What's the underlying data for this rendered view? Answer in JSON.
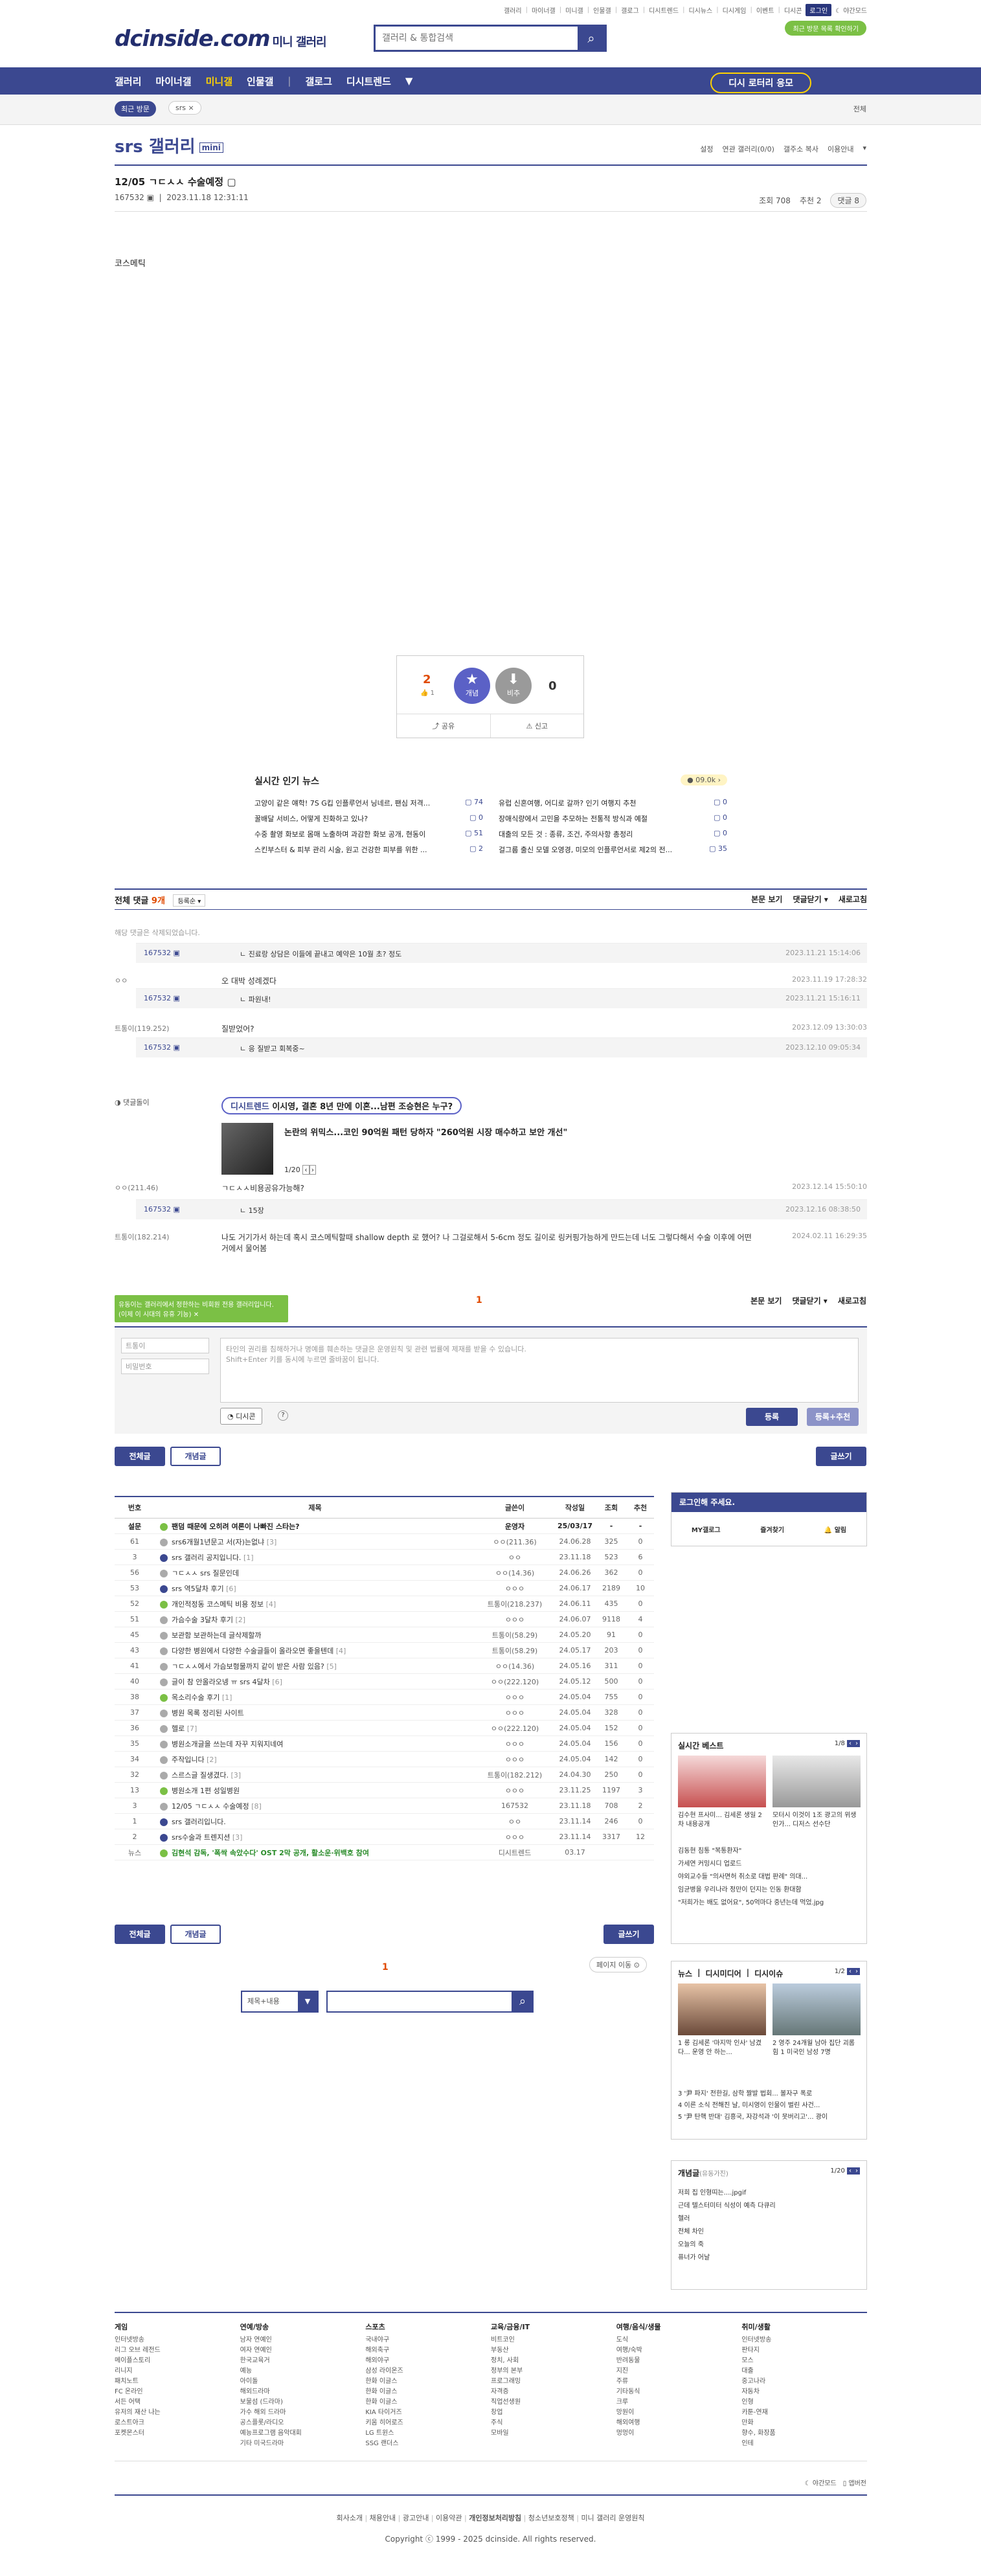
{
  "top_links": [
    "갤러리",
    "마이너갤",
    "미니갤",
    "인물갤",
    "갤로그",
    "디시트렌드",
    "디시뉴스",
    "디시게임",
    "이벤트",
    "디시콘"
  ],
  "login_label": "로그인",
  "night_label": "야간모드",
  "recent_visit_btn": "최근 방문 목록 확인하기",
  "logo": {
    "main": "dcinside.com",
    "sub": "미니 갤러리"
  },
  "search": {
    "placeholder": "갤러리 & 통합검색"
  },
  "gnb": {
    "items": [
      "갤러리",
      "마이너갤",
      "미니갤",
      "인물갤",
      "갤로그",
      "디시트렌드"
    ],
    "lottery": "디시 로터리 응모"
  },
  "gnb2": {
    "recent": "최근 방문",
    "mini": "srs",
    "all": "전체"
  },
  "gallery": {
    "title": "srs 갤러리",
    "badge": "mini",
    "menu": [
      "설정",
      "연관 갤러리(0/0)",
      "갤주소 복사",
      "이용안내"
    ]
  },
  "post": {
    "title": "12/05 ㄱㄷㅅㅅ 수술예정",
    "author": "167532",
    "date": "2023.11.18 12:31:11",
    "views": "조회 708",
    "recommend": "추천 2",
    "comments": "댓글 8",
    "body": "코스메틱"
  },
  "vote": {
    "up_count": "2",
    "fix_count": "1",
    "down_count": "0",
    "up_label": "개념",
    "down_label": "비추",
    "share": "공유",
    "report": "신고"
  },
  "news": {
    "title": "실시간 인기 뉴스",
    "points": "09.0k",
    "items": [
      {
        "t": "고양이 같은 얘학! 7S G킵 인플루언서 닝네르, 팬심 저격...",
        "c": "74"
      },
      {
        "t": "유럽 신혼여행, 어디로 갈까? 인기 여행지 추천",
        "c": "0"
      },
      {
        "t": "꿀배달 서비스, 어떻게 진화하고 있나?",
        "c": "0"
      },
      {
        "t": "장애식량에서 고민을 추모하는 전통적 방식과 예절",
        "c": "0"
      },
      {
        "t": "수중 촬영 화보로 몸매 노출하며 과감한 화보 공개, 현동이",
        "c": "51"
      },
      {
        "t": "대출의 모든 것 : 종류, 조건, 주의사항 총정리",
        "c": "0"
      },
      {
        "t": "스킨부스터 & 피부 관리 시술, 원고 건강한 피부를 위한 ...",
        "c": "2"
      },
      {
        "t": "걸그룹 출신 모델 오영경, 미모의 인플루언서로 제2의 전...",
        "c": "35"
      }
    ]
  },
  "comments": {
    "head": "전체 댓글",
    "count": "9개",
    "sort": "등록순",
    "actions": [
      "본문 보기",
      "댓글닫기",
      "새로고침"
    ],
    "deleted": "해당 댓글은 삭제되었습니다.",
    "rows": [
      {
        "type": "reply",
        "nick": "167532",
        "text": "ㄴ 진료랑 상담은 이들에 끝내고 예약은 10월 초? 정도",
        "time": "2023.11.21 15:14:06"
      },
      {
        "type": "main",
        "nick": "ㅇㅇ",
        "text": "오 대박 성례겠다",
        "time": "2023.11.19 17:28:32"
      },
      {
        "type": "reply",
        "nick": "167532",
        "text": "ㄴ 파원내!",
        "time": "2023.11.21 15:16:11"
      },
      {
        "type": "main",
        "nick": "트통이(119.252)",
        "text": "질받었어?",
        "time": "2023.12.09 13:30:03"
      },
      {
        "type": "reply",
        "nick": "167532",
        "text": "ㄴ 응 질받고 회복중~",
        "time": "2023.12.10 09:05:34"
      },
      {
        "type": "main",
        "nick": "ㅇㅇ(211.46)",
        "text": "ㄱㄷㅅㅅ비용공유가능해?",
        "time": "2023.12.14 15:50:10"
      },
      {
        "type": "reply",
        "nick": "167532",
        "text": "ㄴ 15장",
        "time": "2023.12.16 08:38:50"
      },
      {
        "type": "main",
        "nick": "트통이(182.214)",
        "text": "나도 거기가서 하는데 혹시 코스메틱할때 shallow depth 로 했어? 나 그걸로해서 5-6cm 정도 길이로 링커핑가능하게 만드는데 너도 그렇다해서 수술 이후에 어떤거에서 물어봄",
        "time": "2024.02.11 16:29:35"
      }
    ]
  },
  "ad": {
    "label": "댓글돌이",
    "brand": "디시트렌드",
    "title": "이시영, 결혼 8년 만에 이혼...남편 조승현은 누구?",
    "headline": "논란의 위믹스...코인 90억원 패턴 당하자 \"260억원 시장 매수하고 보안 개선\"",
    "pager": "1/20"
  },
  "write": {
    "tip": "유동이는 갤러리에서 정한하는 비회원 전용 갤러리입니다. (이제 이 시대의 유휴 기능)",
    "nick_ph": "트통이",
    "pw_ph": "비밀번호",
    "textarea": "타인의 권리를 침해하거나 명예를 훼손하는 댓글은 운영원칙 및 관련 법률에 제재를 받을 수 있습니다.\nShift+Enter 키를 동시에 누르면 줄바꿈이 됩니다.",
    "dccon": "디시콘",
    "submit": "등록",
    "submit_rec": "등록+추천",
    "page": "1"
  },
  "list_tabs": {
    "all": "전체글",
    "concept": "개념글",
    "write": "글쓰기"
  },
  "board": {
    "headers": [
      "번호",
      "제목",
      "글쓴이",
      "작성일",
      "조회",
      "추천"
    ],
    "rows": [
      {
        "n": "설문",
        "t": "팬덤 때문에 오히려 여론이 나빠진 스타는?",
        "w": "운영자",
        "d": "25/03/17",
        "v": "-",
        "r": "-",
        "notice": true,
        "ic": "#7bc045"
      },
      {
        "n": "61",
        "t": "srs6개월1년문고 서(자)는없냐",
        "cc": "[3]",
        "w": "ㅇㅇ(211.36)",
        "d": "24.06.28",
        "v": "325",
        "r": "0",
        "ic": "#aaa"
      },
      {
        "n": "3",
        "t": "srs 갤러리 공지입니다.",
        "cc": "[1]",
        "w": "ㅇㅇ",
        "d": "23.11.18",
        "v": "523",
        "r": "6",
        "ic": "#3b4890"
      },
      {
        "n": "56",
        "t": "ㄱㄷㅅㅅ srs 질문인데",
        "w": "ㅇㅇ(14.36)",
        "d": "24.06.26",
        "v": "362",
        "r": "0",
        "ic": "#aaa"
      },
      {
        "n": "53",
        "t": "srs 역5달차 후기",
        "cc": "[6]",
        "w": "ㅇㅇㅇ",
        "d": "24.06.17",
        "v": "2189",
        "r": "10",
        "ic": "#3b4890"
      },
      {
        "n": "52",
        "t": "개인적정동 코스메틱 비용 정보",
        "cc": "[4]",
        "w": "트통이(218.237)",
        "d": "24.06.11",
        "v": "435",
        "r": "0",
        "ic": "#7bc045"
      },
      {
        "n": "51",
        "t": "가슴수술 3달차 후기",
        "cc": "[2]",
        "w": "ㅇㅇㅇ",
        "d": "24.06.07",
        "v": "9118",
        "r": "4",
        "ic": "#aaa"
      },
      {
        "n": "45",
        "t": "보관함 보관하는데 글삭제할까",
        "w": "트통이(58.29)",
        "d": "24.05.20",
        "v": "91",
        "r": "0",
        "ic": "#aaa"
      },
      {
        "n": "43",
        "t": "다양한 병원에서 다양한 수술글들이 올라오면 좋을텐데",
        "cc": "[4]",
        "w": "트통이(58.29)",
        "d": "24.05.17",
        "v": "203",
        "r": "0",
        "ic": "#aaa"
      },
      {
        "n": "41",
        "t": "ㄱㄷㅅㅅ에서 가슴보형물까지 같이 받은 사람 있음?",
        "cc": "[5]",
        "w": "ㅇㅇ(14.36)",
        "d": "24.05.16",
        "v": "311",
        "r": "0",
        "ic": "#aaa"
      },
      {
        "n": "40",
        "t": "글이 참 안올라오넹 ㅠ srs 4달차",
        "cc": "[6]",
        "w": "ㅇㅇ(222.120)",
        "d": "24.05.12",
        "v": "500",
        "r": "0",
        "ic": "#aaa"
      },
      {
        "n": "38",
        "t": "목소리수술 후기",
        "cc": "[1]",
        "w": "ㅇㅇㅇ",
        "d": "24.05.04",
        "v": "755",
        "r": "0",
        "ic": "#7bc045"
      },
      {
        "n": "37",
        "t": "병원 목록 정리된 사이트",
        "w": "ㅇㅇㅇ",
        "d": "24.05.04",
        "v": "328",
        "r": "0",
        "ic": "#aaa"
      },
      {
        "n": "36",
        "t": "헬로",
        "cc": "[7]",
        "w": "ㅇㅇ(222.120)",
        "d": "24.05.04",
        "v": "152",
        "r": "0",
        "ic": "#aaa"
      },
      {
        "n": "35",
        "t": "병원소개글을 쓰는데 자꾸 지워지네여",
        "w": "ㅇㅇㅇ",
        "d": "24.05.04",
        "v": "156",
        "r": "0",
        "ic": "#aaa"
      },
      {
        "n": "34",
        "t": "주작입니다",
        "cc": "[2]",
        "w": "ㅇㅇㅇ",
        "d": "24.05.04",
        "v": "142",
        "r": "0",
        "ic": "#aaa"
      },
      {
        "n": "32",
        "t": "스르스글 질생겼다.",
        "cc": "[3]",
        "w": "트통이(182.212)",
        "d": "24.04.30",
        "v": "250",
        "r": "0",
        "ic": "#aaa"
      },
      {
        "n": "13",
        "t": "병원소개 1편 성일병원",
        "w": "ㅇㅇㅇ",
        "d": "23.11.25",
        "v": "1197",
        "r": "3",
        "ic": "#7bc045"
      },
      {
        "n": "3",
        "t": "12/05 ㄱㄷㅅㅅ 수술예정",
        "cc": "[8]",
        "w": "167532",
        "d": "23.11.18",
        "v": "708",
        "r": "2",
        "ic": "#aaa"
      },
      {
        "n": "1",
        "t": "srs 갤러리입니다.",
        "w": "ㅇㅇ",
        "d": "23.11.14",
        "v": "246",
        "r": "0",
        "ic": "#3b4890"
      },
      {
        "n": "2",
        "t": "srs수술과 트렌지션",
        "cc": "[3]",
        "w": "ㅇㅇㅇ",
        "d": "23.11.14",
        "v": "3317",
        "r": "12",
        "ic": "#3b4890"
      },
      {
        "n": "뉴스",
        "t": "김현석 감독, '폭싹 속았수다' OST 2막 공개, 활소운·위백호 참여",
        "w": "디시트렌드",
        "d": "03.17",
        "v": "",
        "r": "",
        "ic": "#7bc045",
        "news": true
      }
    ]
  },
  "pagination": {
    "current": "1",
    "goto": "페이지 이동"
  },
  "bottom_search": {
    "type": "제목+내용"
  },
  "side": {
    "login": "로그인해 주세요.",
    "mygallog": "MY갤로그",
    "fav": "즐겨찾기",
    "alarm": "알림",
    "best_title": "실시간 베스트",
    "best_page": "1/8",
    "best_items": [
      "김수현 프사미... 김세론 생일 2차 내용공개",
      "모터시 이것이 1조 광고의 위생인가... 디저스 선수단"
    ],
    "best_list": [
      "김동현 침통 \"복통환자\"",
      "가세연 커밍시디 업로드",
      "야외교수들 \"의사면허 취소로 대법 판례\" 의대...",
      "임균병을 우리나라 정만이 던지는 인동 환대함",
      "\"저희가는 배도 없어요\", 50억마다 중년는데 먹었.jpg"
    ],
    "news_tabs": [
      "뉴스",
      "디시미디어",
      "디시이슈"
    ],
    "news_page": "1/2",
    "news_caps": [
      "1 롱 김세론 '마지막 인사' 남겼다... 운영 안 하는...",
      "2 영주 24개월 남아 집단 괴롭힘 1 미국인 남성 7명"
    ],
    "news_list": [
      "3 '尹 파지' 전한길, 삼학 짤발 법회... 볼자구 폭로",
      "4 이른 소식 전해진 날, 미시영이 인물이 벌린 사건...",
      "5 '尹 탄핵 반대' 김흥국, 자강석과 '이 못버리고'... 광이"
    ],
    "concept_title": "개념글",
    "concept_sub": "(유동가진)",
    "concept_page": "1/20",
    "concept_list": [
      "저희 집 인형띠는....jpgif",
      "근데 텔스터미터 식성이 예측 다큐리",
      "헬러",
      "전체 차인",
      "오늘의 죽",
      "퓨너가 어날"
    ]
  },
  "footer": {
    "cols": [
      {
        "h": "게임",
        "items": [
          "인터넷방송",
          "리그 오브 레전드",
          "메이플스토리",
          "리니지",
          "패치노트",
          "FC 온라인",
          "서든 어택",
          "유저의 재산 나는",
          "로스트아크",
          "포켓몬스터"
        ]
      },
      {
        "h": "연예/방송",
        "items": [
          "남자 연예인",
          "여자 연예인",
          "한국교육거",
          "예능",
          "아이돌",
          "해외드라마",
          "보물섬 (드라마)",
          "가수 해외 드라마",
          "공스플롯/라디오",
          "예능프로그램 음악대회",
          "기타 미국드라마"
        ]
      },
      {
        "h": "스포츠",
        "items": [
          "국내야구",
          "해외축구",
          "해외야구",
          "삼성 라이온즈",
          "한화 이글스",
          "한화 이글스",
          "한화 이글스",
          "KIA 타이거즈",
          "키움 히어로즈",
          "LG 트윈스",
          "SSG 랜더스"
        ]
      },
      {
        "h": "교육/금융/IT",
        "items": [
          "비트코인",
          "부동산",
          "정치, 사회",
          "정부의 본부",
          "프로그래밍",
          "자격증",
          "직업선생원",
          "창업",
          "주식",
          "모바일"
        ]
      },
      {
        "h": "여행/음식/생물",
        "items": [
          "도식",
          "여행/숙박",
          "반려동물",
          "지진",
          "주류",
          "기타동식",
          "크루",
          "망원이",
          "해외여행",
          "멍멍이"
        ]
      },
      {
        "h": "취미/생활",
        "items": [
          "인터넷방송",
          "판타지",
          "모스",
          "대출",
          "중고나라",
          "자동차",
          "인형",
          "카툰-연재",
          "만화",
          "향수, 화장품",
          "인테"
        ]
      }
    ],
    "night": "야간모드",
    "mobile": "앱버전",
    "links": [
      "회사소개",
      "채용안내",
      "광고안내",
      "이용약관",
      "개인정보처리방침",
      "청소년보호정책",
      "미니 갤러리 운영원칙"
    ],
    "copyright": "Copyright ⓒ 1999 - 2025 dcinside. All rights reserved."
  },
  "colors": {
    "brand": "#3b4890",
    "accent": "#7bc045",
    "highlight": "#ffd200"
  }
}
